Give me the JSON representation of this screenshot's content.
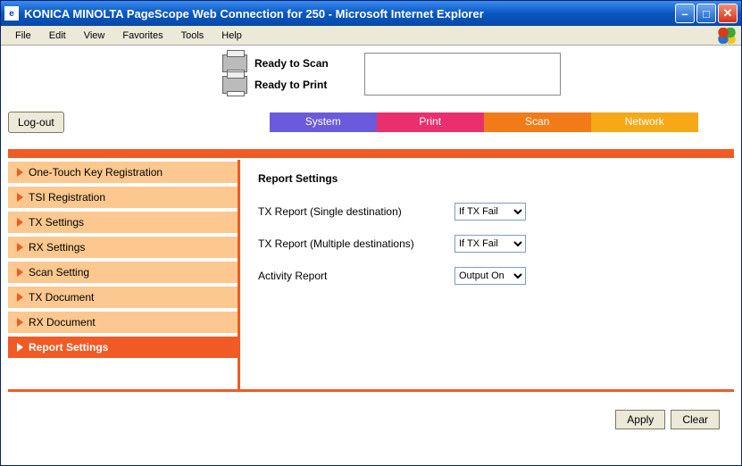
{
  "window": {
    "title": "KONICA MINOLTA PageScope Web Connection for 250 - Microsoft Internet Explorer"
  },
  "menubar": [
    "File",
    "Edit",
    "View",
    "Favorites",
    "Tools",
    "Help"
  ],
  "status": {
    "scan": "Ready to Scan",
    "print": "Ready to Print"
  },
  "buttons": {
    "logout": "Log-out",
    "apply": "Apply",
    "clear": "Clear"
  },
  "tabs": {
    "system": "System",
    "print": "Print",
    "scan": "Scan",
    "network": "Network"
  },
  "sidebar": {
    "items": [
      "One-Touch Key Registration",
      "TSI Registration",
      "TX Settings",
      "RX Settings",
      "Scan Setting",
      "TX Document",
      "RX Document",
      "Report Settings"
    ],
    "activeIndex": 7
  },
  "page": {
    "heading": "Report Settings",
    "fields": {
      "tx_single": {
        "label": "TX Report (Single destination)",
        "value": "If TX Fail"
      },
      "tx_multi": {
        "label": "TX Report (Multiple destinations)",
        "value": "If TX Fail"
      },
      "activity": {
        "label": "Activity Report",
        "value": "Output On"
      }
    }
  }
}
